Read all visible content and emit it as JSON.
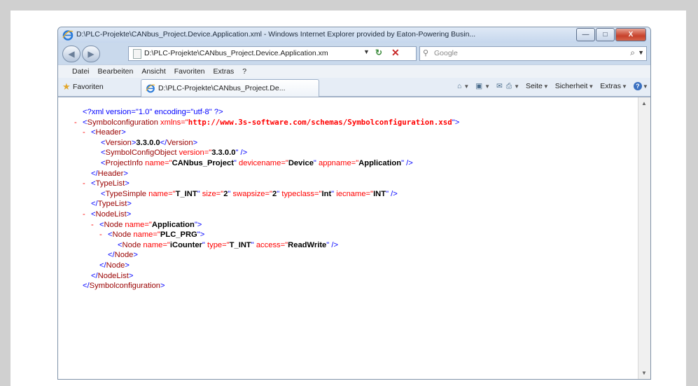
{
  "window": {
    "title": "D:\\PLC-Projekte\\CANbus_Project.Device.Application.xml - Windows Internet Explorer provided by Eaton-Powering Busin...",
    "minimize_glyph": "—",
    "maximize_glyph": "□",
    "close_glyph": "X"
  },
  "nav": {
    "back_glyph": "◀",
    "forward_glyph": "▶",
    "address": "D:\\PLC-Projekte\\CANbus_Project.Device.Application.xm",
    "search_placeholder": "Google"
  },
  "menu": [
    "Datei",
    "Bearbeiten",
    "Ansicht",
    "Favoriten",
    "Extras",
    "?"
  ],
  "favorites": {
    "label": "Favoriten",
    "tab_title": "D:\\PLC-Projekte\\CANbus_Project.De...",
    "commands": {
      "page": "Seite",
      "security": "Sicherheit",
      "tools": "Extras"
    }
  },
  "xml": {
    "decl": "<?xml version=\"1.0\" encoding=\"utf-8\" ?>",
    "symbolconfiguration_open": "<Symbolconfiguration",
    "xmlns_attr": " xmlns=\"",
    "xmlns_value": "http://www.3s-software.com/schemas/Symbolconfiguration.xsd",
    "header_open": "<Header>",
    "version_open": "<Version>",
    "version_value": "3.3.0.0",
    "version_close": "</Version>",
    "symbolconfigobject_open": "<SymbolConfigObject",
    "symbolconfigobject_attr": " version=\"",
    "symbolconfigobject_value": "3.3.0.0",
    "projectinfo_open": "<ProjectInfo",
    "projectinfo_name_attr": " name=\"",
    "projectinfo_name_value": "CANbus_Project",
    "projectinfo_device_attr": " devicename=\"",
    "projectinfo_device_value": "Device",
    "projectinfo_app_attr": " appname=\"",
    "projectinfo_app_value": "Application",
    "header_close": "</Header>",
    "typelist_open": "<TypeList>",
    "typesimple_open": "<TypeSimple",
    "typesimple_name_attr": " name=\"",
    "typesimple_name_value": "T_INT",
    "typesimple_size_attr": " size=\"",
    "typesimple_size_value": "2",
    "typesimple_swap_attr": " swapsize=\"",
    "typesimple_swap_value": "2",
    "typesimple_class_attr": " typeclass=\"",
    "typesimple_class_value": "Int",
    "typesimple_iec_attr": " iecname=\"",
    "typesimple_iec_value": "INT",
    "typelist_close": "</TypeList>",
    "nodelist_open": "<NodeList>",
    "node_app_open": "<Node",
    "node_app_attr": " name=\"",
    "node_app_value": "Application",
    "node_prg_open": "<Node",
    "node_prg_attr": " name=\"",
    "node_prg_value": "PLC_PRG",
    "node_counter_open": "<Node",
    "node_counter_name_attr": " name=\"",
    "node_counter_name_value": "iCounter",
    "node_counter_type_attr": " type=\"",
    "node_counter_type_value": "T_INT",
    "node_counter_access_attr": " access=\"",
    "node_counter_access_value": "ReadWrite",
    "node_close": "</Node>",
    "nodelist_close": "</NodeList>",
    "symbolconfiguration_close": "</Symbolconfiguration>",
    "minus": "-"
  }
}
